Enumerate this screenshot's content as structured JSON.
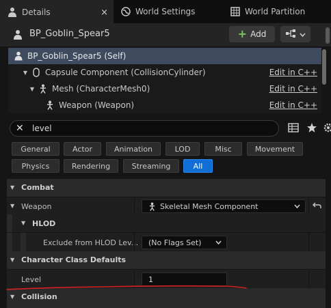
{
  "tabs": [
    {
      "label": "Details",
      "icon": "details-icon"
    },
    {
      "label": "World Settings",
      "icon": "globe-icon"
    },
    {
      "label": "World Partition",
      "icon": "grid-icon"
    }
  ],
  "tab_close": "×",
  "header": {
    "actor_name": "BP_Goblin_Spear5",
    "add_label": "Add",
    "add_symbol": "+"
  },
  "tree": [
    {
      "label": "BP_Goblin_Spear5 (Self)",
      "edit": ""
    },
    {
      "label": "Capsule Component (CollisionCylinder)",
      "edit": "Edit in C++"
    },
    {
      "label": "Mesh (CharacterMesh0)",
      "edit": "Edit in C++"
    },
    {
      "label": "Weapon (Weapon)",
      "edit": "Edit in C++"
    }
  ],
  "search": {
    "value": "level",
    "clear": "✕"
  },
  "filters": [
    {
      "label": "General",
      "active": false
    },
    {
      "label": "Actor",
      "active": false
    },
    {
      "label": "Animation",
      "active": false
    },
    {
      "label": "LOD",
      "active": false
    },
    {
      "label": "Misc",
      "active": false
    },
    {
      "label": "Movement",
      "active": false
    },
    {
      "label": "Physics",
      "active": false
    },
    {
      "label": "Rendering",
      "active": false
    },
    {
      "label": "Streaming",
      "active": false
    },
    {
      "label": "All",
      "active": true
    }
  ],
  "details": {
    "combat": {
      "label": "Combat"
    },
    "weapon": {
      "label": "Weapon",
      "value": "Skeletal Mesh Component"
    },
    "hlod": {
      "label": "HLOD"
    },
    "exclude_hlod": {
      "label": "Exclude from HLOD Lev...",
      "value": "(No Flags Set)"
    },
    "char_class": {
      "label": "Character Class Defaults"
    },
    "level": {
      "label": "Level",
      "value": "1"
    },
    "collision": {
      "label": "Collision"
    }
  },
  "colors": {
    "accent": "#0f6fd6",
    "selection": "#3e4a5e",
    "add_plus": "#79c95b",
    "annotation": "#d42020"
  }
}
